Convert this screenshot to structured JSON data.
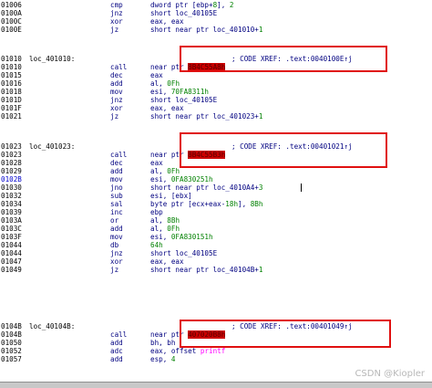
{
  "watermark": "CSDN @Kiopler",
  "lines": [
    {
      "addr": "01006",
      "mnem": "cmp",
      "op": [
        {
          "t": "dword ptr [ebp+"
        },
        {
          "t": "8",
          "c": "num"
        },
        {
          "t": "], "
        },
        {
          "t": "2",
          "c": "num"
        }
      ]
    },
    {
      "addr": "0100A",
      "mnem": "jnz",
      "op": [
        {
          "t": "short loc_40105E"
        }
      ]
    },
    {
      "addr": "0100C",
      "mnem": "xor",
      "op": [
        {
          "t": "eax, eax"
        }
      ]
    },
    {
      "addr": "0100E",
      "mnem": "jz",
      "op": [
        {
          "t": "short near ptr loc_401010+"
        },
        {
          "t": "1",
          "c": "num"
        }
      ]
    },
    {
      "addr": "01010",
      "label": "loc_401010:",
      "comment": "; CODE XREF: .text:0040100E↑j"
    },
    {
      "addr": "01010",
      "mnem": "call",
      "op": [
        {
          "t": "near ptr "
        },
        {
          "t": "8B4C55A8h",
          "c": "hl"
        }
      ]
    },
    {
      "addr": "01015",
      "mnem": "dec",
      "op": [
        {
          "t": "eax"
        }
      ]
    },
    {
      "addr": "01016",
      "mnem": "add",
      "op": [
        {
          "t": "al, "
        },
        {
          "t": "0Fh",
          "c": "num"
        }
      ]
    },
    {
      "addr": "01018",
      "mnem": "mov",
      "op": [
        {
          "t": "esi, "
        },
        {
          "t": "70FA8311h",
          "c": "num"
        }
      ]
    },
    {
      "addr": "0101D",
      "mnem": "jnz",
      "op": [
        {
          "t": "short loc_40105E"
        }
      ]
    },
    {
      "addr": "0101F",
      "mnem": "xor",
      "op": [
        {
          "t": "eax, eax"
        }
      ]
    },
    {
      "addr": "01021",
      "mnem": "jz",
      "op": [
        {
          "t": "short near ptr loc_401023+"
        },
        {
          "t": "1",
          "c": "num"
        }
      ]
    },
    {
      "addr": "01023",
      "label": "loc_401023:",
      "comment": "; CODE XREF: .text:00401021↑j"
    },
    {
      "addr": "01023",
      "mnem": "call",
      "op": [
        {
          "t": "near ptr "
        },
        {
          "t": "8B4C55B3h",
          "c": "hl"
        }
      ]
    },
    {
      "addr": "01028",
      "mnem": "dec",
      "op": [
        {
          "t": "eax"
        }
      ]
    },
    {
      "addr": "01029",
      "mnem": "add",
      "op": [
        {
          "t": "al, "
        },
        {
          "t": "0Fh",
          "c": "num"
        }
      ]
    },
    {
      "addr": "0102B",
      "hl": true,
      "mnem": "mov",
      "op": [
        {
          "t": "esi, "
        },
        {
          "t": "0FA830251h",
          "c": "num"
        }
      ]
    },
    {
      "addr": "01030",
      "mnem": "jno",
      "op": [
        {
          "t": "short near ptr loc_4010A4+"
        },
        {
          "t": "3",
          "c": "num"
        }
      ]
    },
    {
      "addr": "01032",
      "mnem": "sub",
      "op": [
        {
          "t": "esi, [ebx]"
        }
      ]
    },
    {
      "addr": "01034",
      "mnem": "sal",
      "op": [
        {
          "t": "byte ptr [ecx+eax-"
        },
        {
          "t": "18h",
          "c": "num"
        },
        {
          "t": "], "
        },
        {
          "t": "8Bh",
          "c": "num"
        }
      ]
    },
    {
      "addr": "01039",
      "mnem": "inc",
      "op": [
        {
          "t": "ebp"
        }
      ]
    },
    {
      "addr": "0103A",
      "mnem": "or",
      "op": [
        {
          "t": "al, "
        },
        {
          "t": "8Bh",
          "c": "num"
        }
      ]
    },
    {
      "addr": "0103C",
      "mnem": "add",
      "op": [
        {
          "t": "al, "
        },
        {
          "t": "0Fh",
          "c": "num"
        }
      ]
    },
    {
      "addr": "0103F",
      "mnem": "mov",
      "op": [
        {
          "t": "esi, "
        },
        {
          "t": "0FA830151h",
          "c": "num"
        }
      ]
    },
    {
      "addr": "01044",
      "mnem": "db",
      "op": [
        {
          "t": "64h",
          "c": "num"
        }
      ]
    },
    {
      "addr": "01044",
      "mnem": "jnz",
      "op": [
        {
          "t": "short loc_40105E"
        }
      ]
    },
    {
      "addr": "01047",
      "mnem": "xor",
      "op": [
        {
          "t": "eax, eax"
        }
      ]
    },
    {
      "addr": "01049",
      "mnem": "jz",
      "op": [
        {
          "t": "short near ptr loc_40104B+"
        },
        {
          "t": "1",
          "c": "num"
        }
      ]
    },
    {
      "addr": "0104B",
      "label": "loc_40104B:",
      "comment": "; CODE XREF: .text:00401049↑j"
    },
    {
      "addr": "0104B",
      "mnem": "call",
      "op": [
        {
          "t": "near ptr "
        },
        {
          "t": "407020B8h",
          "c": "hl"
        }
      ]
    },
    {
      "addr": "01050",
      "mnem": "add",
      "op": [
        {
          "t": "bh, bh"
        }
      ]
    },
    {
      "addr": "01052",
      "mnem": "adc",
      "op": [
        {
          "t": "eax, offset "
        },
        {
          "t": "printf",
          "c": "fn"
        }
      ]
    },
    {
      "addr": "01057",
      "mnem": "add",
      "op": [
        {
          "t": "esp, "
        },
        {
          "t": "4",
          "c": "num"
        }
      ]
    }
  ]
}
